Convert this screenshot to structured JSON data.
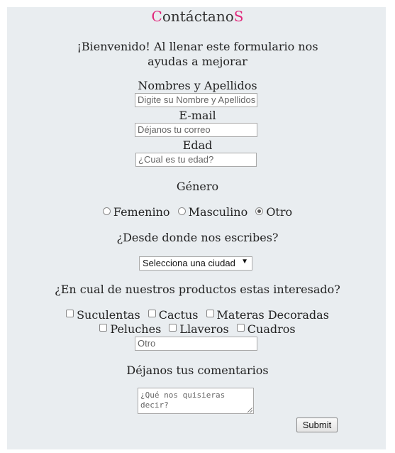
{
  "title": {
    "first": "C",
    "middle": "ontáctano",
    "last": "S"
  },
  "intro": "¡Bienvenido! Al llenar este formulario nos ayudas a mejorar",
  "name": {
    "label": "Nombres y Apellidos",
    "placeholder": "Digite su Nombre y Apellidos"
  },
  "email": {
    "label": "E-mail",
    "placeholder": "Déjanos tu correo"
  },
  "age": {
    "label": "Edad",
    "placeholder": "¿Cual es tu edad?"
  },
  "gender": {
    "label": "Género",
    "options": [
      {
        "label": "Femenino",
        "selected": false
      },
      {
        "label": "Masculino",
        "selected": false
      },
      {
        "label": "Otro",
        "selected": true
      }
    ]
  },
  "city": {
    "label": "¿Desde donde nos escribes?",
    "selected": "Selecciona una ciudad"
  },
  "products": {
    "label": "¿En cual de nuestros productos estas interesado?",
    "options": [
      "Suculentas",
      "Cactus",
      "Materas Decoradas",
      "Peluches",
      "Llaveros",
      "Cuadros"
    ],
    "other_placeholder": "Otro"
  },
  "comments": {
    "label": "Déjanos tus comentarios",
    "placeholder": "¿Qué nos quisieras decir?"
  },
  "submit_label": "Submit",
  "colors": {
    "background": "#e9edf0",
    "accent": "#e0267a"
  }
}
